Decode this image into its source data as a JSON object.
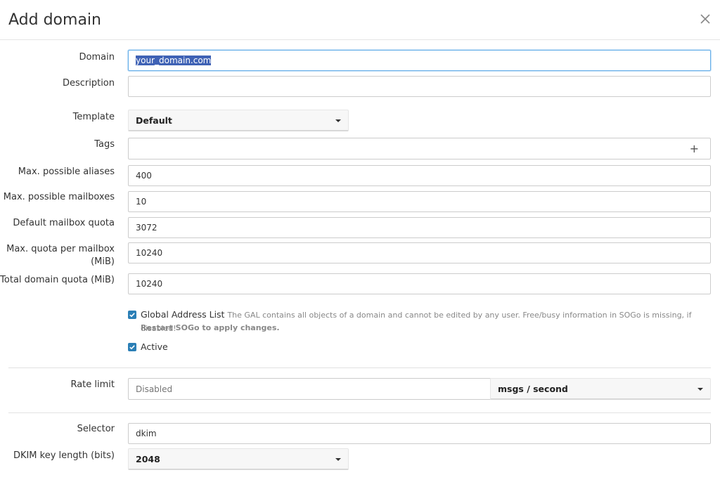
{
  "modal": {
    "title": "Add domain"
  },
  "fields": {
    "domain": {
      "label": "Domain",
      "value": "your_domain.com"
    },
    "description": {
      "label": "Description",
      "value": ""
    },
    "template": {
      "label": "Template",
      "value": "Default"
    },
    "tags": {
      "label": "Tags",
      "value": "",
      "add_glyph": "+"
    },
    "max_aliases": {
      "label": "Max. possible aliases",
      "value": "400"
    },
    "max_mailboxes": {
      "label": "Max. possible mailboxes",
      "value": "10"
    },
    "default_quota": {
      "label": "Default mailbox quota",
      "value": "3072"
    },
    "max_quota": {
      "label_line1": "Max. quota per mailbox",
      "label_line2": "(MiB)",
      "value": "10240"
    },
    "total_quota": {
      "label": "Total domain quota (MiB)",
      "value": "10240"
    }
  },
  "options": {
    "gal": {
      "label": "Global Address List",
      "checked": true,
      "help": "The GAL contains all objects of a domain and cannot be edited by any user. Free/busy information in SOGo is missing, if disabled!",
      "help_bold": "Restart SOGo to apply changes."
    },
    "active": {
      "label": "Active",
      "checked": true
    }
  },
  "rate_limit": {
    "label": "Rate limit",
    "placeholder": "Disabled",
    "unit": "msgs / second"
  },
  "dkim": {
    "selector": {
      "label": "Selector",
      "value": "dkim"
    },
    "key_length": {
      "label": "DKIM key length (bits)",
      "value": "2048"
    }
  },
  "colors": {
    "checkbox": "#2b7fb6",
    "focus_border": "#66afe9",
    "selection": "#3f62b5"
  }
}
